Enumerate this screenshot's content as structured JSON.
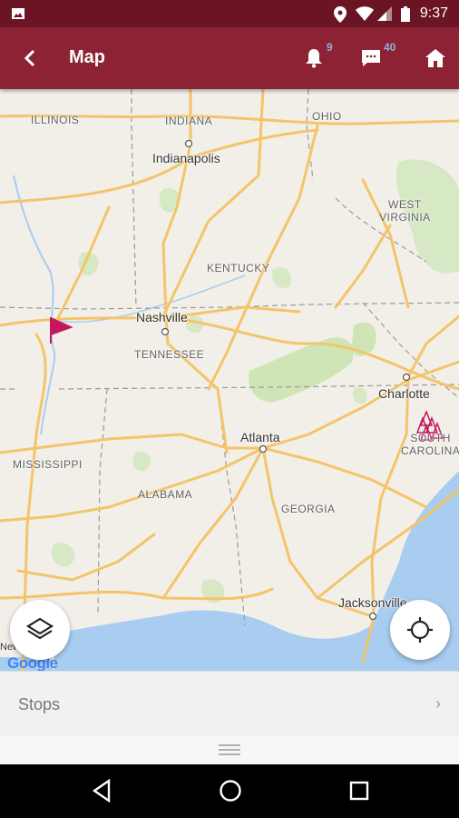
{
  "status_bar": {
    "time": "9:37"
  },
  "app_bar": {
    "title": "Map",
    "notifications_count": "9",
    "messages_count": "40"
  },
  "map": {
    "state_labels": [
      "ILLINOIS",
      "INDIANA",
      "OHIO",
      "WEST\nVIRGINIA",
      "KENTUCKY",
      "TENNESSEE",
      "MISSISSIPPI",
      "ALABAMA",
      "GEORGIA",
      "SOUTH\nCAROLINA"
    ],
    "cities": [
      "Indianapolis",
      "Nashville",
      "Charlotte",
      "Atlanta",
      "Jacksonville"
    ],
    "partial_label": "New",
    "attribution": "Google"
  },
  "bottom_sheet": {
    "stops_label": "Stops"
  },
  "colors": {
    "status_bar": "#6b1524",
    "app_bar": "#8c2233",
    "marker": "#c2185b",
    "water": "#a8cdf0",
    "road": "#f4c46a"
  }
}
